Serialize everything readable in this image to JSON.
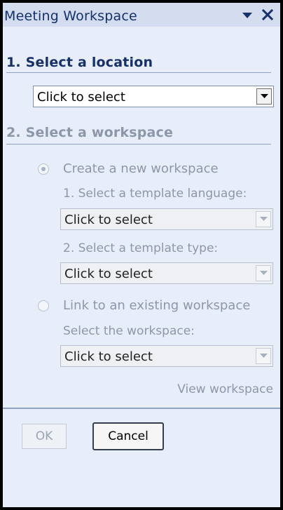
{
  "pane": {
    "title": "Meeting Workspace",
    "dropdown_icon": "triangle-down-icon",
    "close_icon": "close-icon"
  },
  "section1": {
    "heading": "1. Select a location",
    "location_select": "Click to select"
  },
  "section2": {
    "heading": "2. Select a workspace",
    "option_create": {
      "label": "Create a new workspace",
      "selected": true,
      "language_label": "1. Select a template language:",
      "language_select": "Click to select",
      "type_label": "2. Select a template type:",
      "type_select": "Click to select"
    },
    "option_link": {
      "label": "Link to an existing workspace",
      "selected": false,
      "workspace_label": "Select the workspace:",
      "workspace_select": "Click to select",
      "view_link": "View workspace"
    }
  },
  "buttons": {
    "ok": "OK",
    "cancel": "Cancel"
  },
  "colors": {
    "pane_background": "#e8eef9",
    "heading_active": "#15306a",
    "disabled_text": "#8c97aa",
    "frame": "#000000"
  }
}
